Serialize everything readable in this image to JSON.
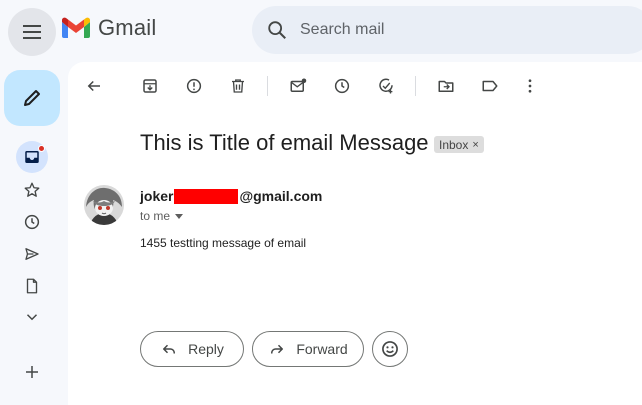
{
  "header": {
    "app_name": "Gmail",
    "search_placeholder": "Search mail"
  },
  "sidebar": {
    "icons": [
      "menu-icon",
      "pencil-icon",
      "inbox-icon",
      "star-icon",
      "clock-icon",
      "send-icon",
      "draft-icon",
      "chevron-down-icon",
      "plus-icon"
    ],
    "inbox_unread_dot": true
  },
  "toolbar": {
    "icons": [
      "back-arrow-icon",
      "archive-icon",
      "report-spam-icon",
      "delete-icon",
      "mark-unread-icon",
      "snooze-icon",
      "add-task-icon",
      "move-to-icon",
      "label-icon",
      "more-vert-icon"
    ]
  },
  "email": {
    "subject": "This is Title of email Message",
    "label": "Inbox",
    "label_remove": "×",
    "sender_prefix": "joker",
    "sender_suffix": "@gmail.com",
    "to_line": "to me",
    "body": "1455 testting message of email"
  },
  "actions": {
    "reply": "Reply",
    "forward": "Forward"
  },
  "colors": {
    "background": "#f6f8fc",
    "compose": "#c2e7ff",
    "search": "#e9eef6",
    "redaction": "#ff0000",
    "unread_dot": "#d93025"
  }
}
